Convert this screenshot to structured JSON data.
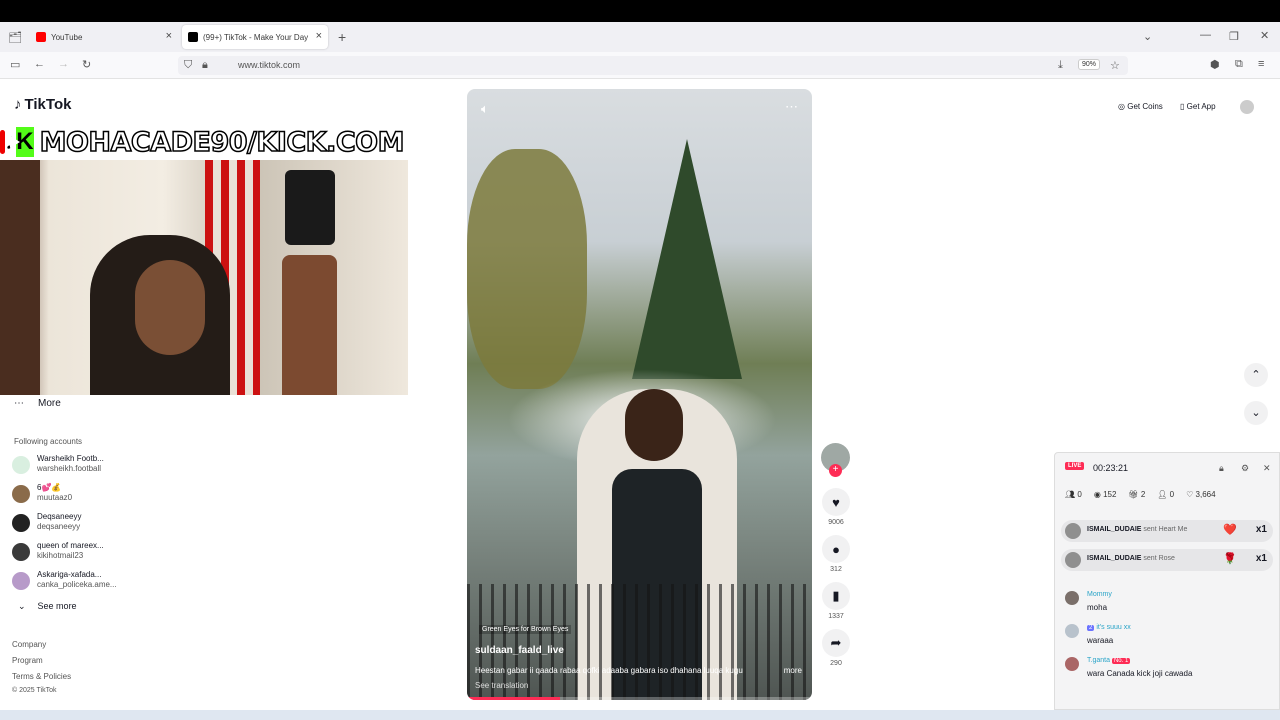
{
  "browser": {
    "tabs": [
      {
        "label": "YouTube",
        "color": "#ff0000"
      },
      {
        "label": "(99+) TikTok - Make Your Day",
        "color": "#000000"
      }
    ],
    "url": "www.tiktok.com",
    "zoom": "90%"
  },
  "tiktok": {
    "logo": "TikTok",
    "header_buttons": {
      "get_coins": "Get Coins",
      "get_app": "Get App"
    }
  },
  "overlay": {
    "banner_text": "MOHACADE90/KICK.COM"
  },
  "sidebar": {
    "more_label": "More",
    "following_header": "Following accounts",
    "accounts": [
      {
        "name": "Warsheikh Footb...",
        "handle": "warsheikh.football"
      },
      {
        "name": "6💕💰",
        "handle": "muutaaz0"
      },
      {
        "name": "Deqsaneeyy",
        "handle": "deqsaneeyy"
      },
      {
        "name": "queen of mareex...",
        "handle": "kikihotmail23"
      },
      {
        "name": "Askariga-xafada...",
        "handle": "canka_policeka.ame..."
      }
    ],
    "see_more": "See more",
    "footer": [
      "Company",
      "Program",
      "Terms & Policies",
      "© 2025 TikTok"
    ]
  },
  "video": {
    "song": "Green Eyes for Brown Eyes",
    "username": "suldaan_faald_live",
    "description": "Heestan gabar ii qaada rabaa qofki adaaba gabara iso dhahana luuqa kugu",
    "more": "more",
    "see_translation": "See translation",
    "progress": 0.27,
    "likes": "9006",
    "comments": "312",
    "saves": "1337",
    "shares": "290"
  },
  "live_panel": {
    "badge": "LIVE",
    "timer": "00:23:21",
    "stats": [
      "0",
      "152",
      "2",
      "0",
      "3,664"
    ],
    "gifts": [
      {
        "user": "ISMAIL_DUDAIE",
        "action": "sent Heart Me",
        "count": "x1"
      },
      {
        "user": "ISMAIL_DUDAIE",
        "action": "sent Rose",
        "count": "x1"
      }
    ],
    "messages": [
      {
        "user": "Mommy",
        "level": "",
        "badge": "",
        "text": "moha"
      },
      {
        "user": "it's suuu xx",
        "level": "2",
        "badge": "",
        "text": "waraaa"
      },
      {
        "user": "T.ganta",
        "level": "",
        "badge": "No. 1",
        "text": "wara Canada kick joji cawada"
      }
    ]
  },
  "colors": {
    "accent": "#fe2c55",
    "kick": "#53fc18"
  }
}
